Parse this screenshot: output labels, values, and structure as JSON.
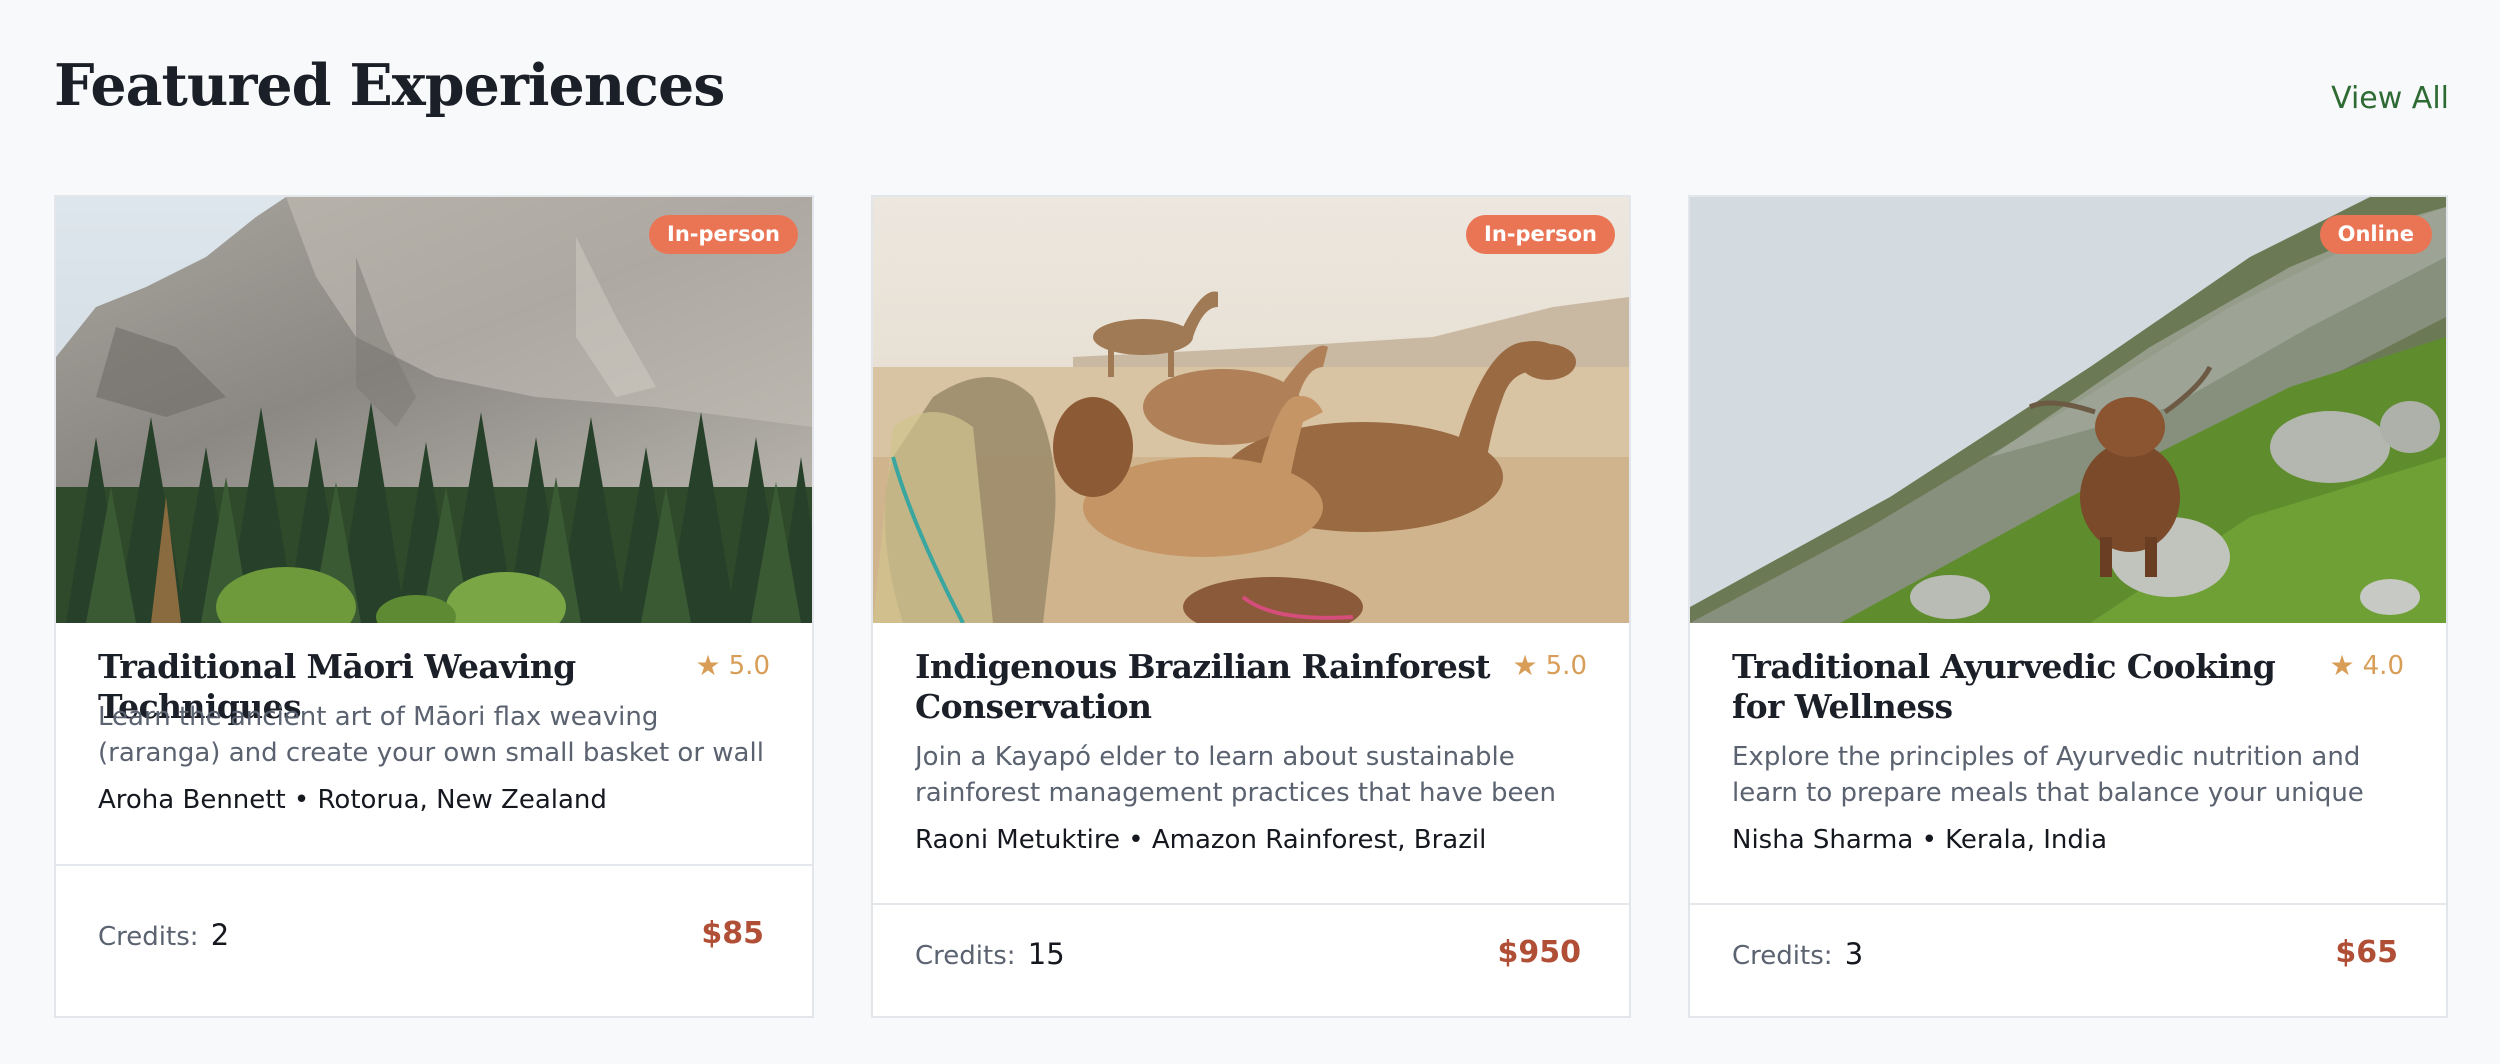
{
  "section": {
    "title": "Featured Experiences",
    "view_all_label": "View All"
  },
  "cards": [
    {
      "badge": "In-person",
      "title": "Traditional Māori Weaving Techniques",
      "rating": "5.0",
      "description": "Learn the ancient art of Māori flax weaving (raranga) and create your own small basket or wall hanging. This...",
      "host": "Aroha Bennett • Rotorua, New Zealand",
      "credits_label": "Credits:",
      "credits": "2",
      "price": "$85"
    },
    {
      "badge": "In-person",
      "title": "Indigenous Brazilian Rainforest Conservation",
      "rating": "5.0",
      "description": "Join a Kayapó elder to learn about sustainable rainforest management practices that have been maintained for...",
      "host": "Raoni Metuktire • Amazon Rainforest, Brazil",
      "credits_label": "Credits:",
      "credits": "15",
      "price": "$950"
    },
    {
      "badge": "Online",
      "title": "Traditional Ayurvedic Cooking for Wellness",
      "rating": "4.0",
      "description": "Explore the principles of Ayurvedic nutrition and learn to prepare meals that balance your unique constitution....",
      "host": "Nisha Sharma • Kerala, India",
      "credits_label": "Credits:",
      "credits": "3",
      "price": "$65"
    }
  ],
  "colors": {
    "badge": "#ea7555",
    "price": "#b04f36",
    "rating": "#d89d57",
    "link": "#2e6b34"
  },
  "icons": {
    "rating": "star-icon"
  }
}
